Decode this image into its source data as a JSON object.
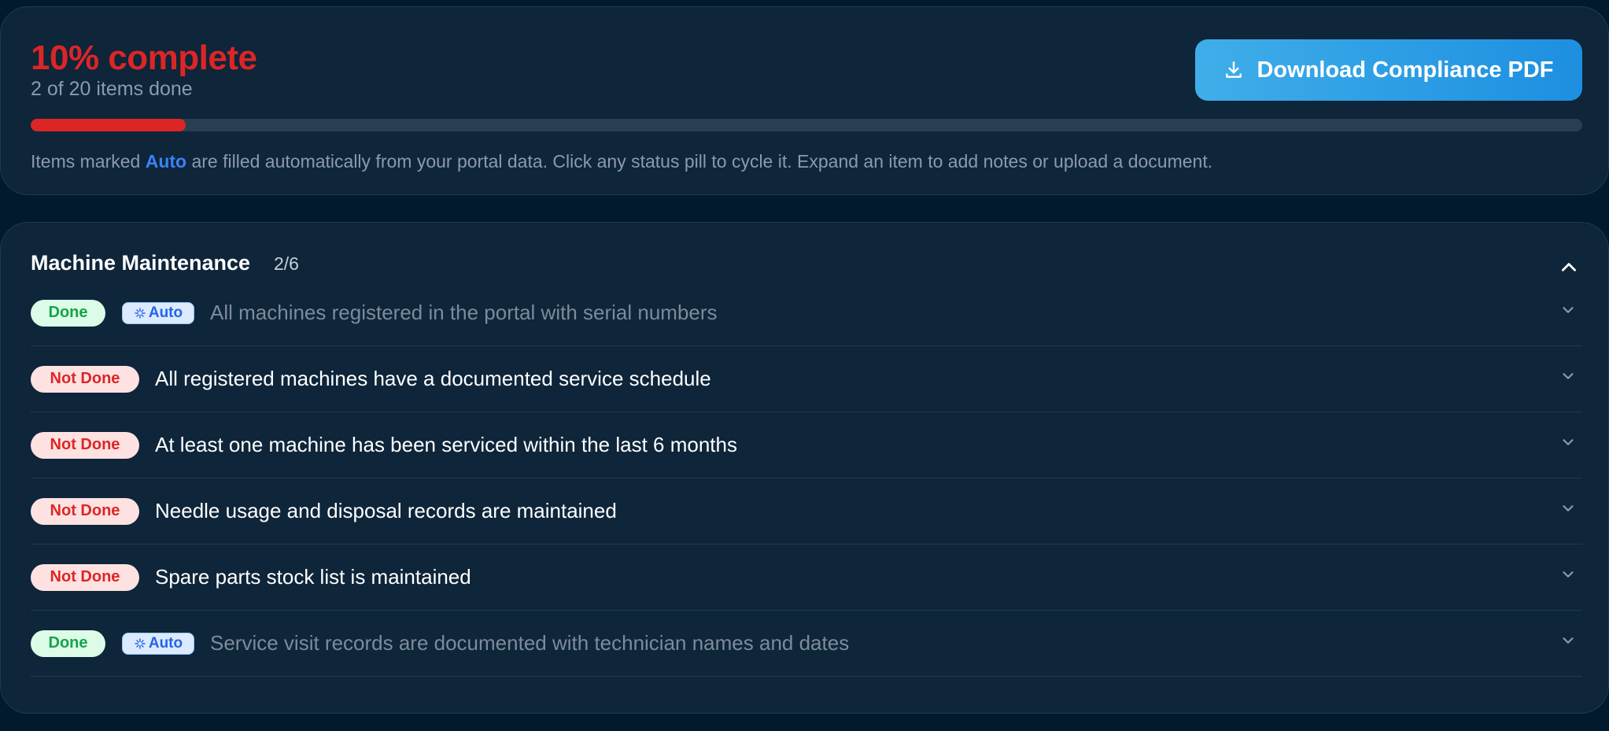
{
  "summary": {
    "percent_label": "10% complete",
    "percent": 10,
    "items_done_label": "2 of 20 items done",
    "download_label": "Download Compliance PDF",
    "hint_before": "Items marked ",
    "hint_auto": "Auto",
    "hint_after": " are filled automatically from your portal data. Click any status pill to cycle it. Expand an item to add notes or upload a document."
  },
  "section": {
    "title": "Machine Maintenance",
    "count": "2/6",
    "items": [
      {
        "status": "Done",
        "auto": "Auto",
        "text": "All machines registered in the portal with serial numbers"
      },
      {
        "status": "Not Done",
        "text": "All registered machines have a documented service schedule"
      },
      {
        "status": "Not Done",
        "text": "At least one machine has been serviced within the last 6 months"
      },
      {
        "status": "Not Done",
        "text": "Needle usage and disposal records are maintained"
      },
      {
        "status": "Not Done",
        "text": "Spare parts stock list is maintained"
      },
      {
        "status": "Done",
        "auto": "Auto",
        "text": "Service visit records are documented with technician names and dates"
      }
    ]
  },
  "colors": {
    "background": "#021a2e",
    "card": "#0e253a",
    "danger": "#dc2626",
    "success": "#16a34a",
    "accent": "#3b82f6"
  },
  "icons": {
    "download": "download-icon",
    "collapse": "chevron-up-icon",
    "expand": "chevron-down-icon",
    "auto": "sparkle-icon"
  }
}
